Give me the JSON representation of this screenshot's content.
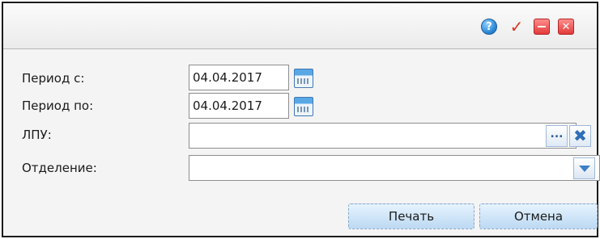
{
  "titlebar": {
    "icons": [
      "help-icon",
      "check-icon",
      "minimize-icon",
      "close-icon"
    ],
    "help_glyph": "?",
    "check_glyph": "✓",
    "close_glyph": "✕"
  },
  "form": {
    "period_from": {
      "label": "Период с:",
      "value": "04.04.2017",
      "icon": "calendar-icon"
    },
    "period_to": {
      "label": "Период по:",
      "value": "04.04.2017",
      "icon": "calendar-icon"
    },
    "lpu": {
      "label": "ЛПУ:",
      "value": "",
      "browse_glyph": "...",
      "clear_glyph": "✖"
    },
    "department": {
      "label": "Отделение:",
      "value": "",
      "icon": "dropdown-arrow-icon"
    }
  },
  "buttons": {
    "print_label": "Печать",
    "cancel_label": "Отмена"
  },
  "colors": {
    "button_top": "#e6f3ff",
    "button_bottom": "#bcd9f2",
    "accent_blue": "#3f7fc6",
    "close_red": "#e23a3a"
  }
}
